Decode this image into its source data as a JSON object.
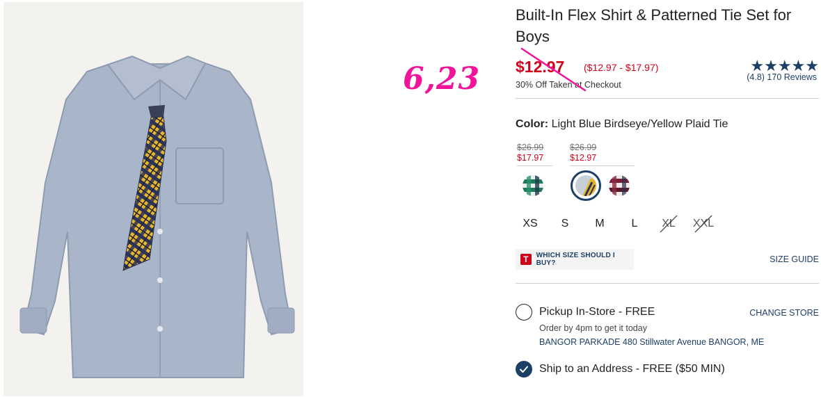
{
  "product": {
    "title": "Built-In Flex Shirt & Patterned Tie Set for Boys",
    "price_now": "$12.97",
    "price_range": "($12.97 - $17.97)",
    "promo": "30% Off Taken at Checkout",
    "stars": "★★★★★",
    "rating_text": "(4.8) 170 Reviews",
    "rating": 4.8,
    "image_icon": "shirt-and-tie-photo"
  },
  "annotation": {
    "text": "6,23",
    "color": "#f0149b"
  },
  "color_selector": {
    "label": "Color:",
    "value": "Light Blue Birdseye/Yellow Plaid Tie",
    "price_groups": [
      {
        "was": "$26.99",
        "now": "$17.97"
      },
      {
        "was": "$26.99",
        "now": "$12.97"
      }
    ],
    "swatches": [
      {
        "name": "green-plaid",
        "selected": false
      },
      {
        "name": "blue-yellow-plaid",
        "selected": true
      },
      {
        "name": "burgundy-plaid",
        "selected": false
      }
    ]
  },
  "sizes": [
    {
      "label": "XS",
      "available": true
    },
    {
      "label": "S",
      "available": true
    },
    {
      "label": "M",
      "available": true
    },
    {
      "label": "L",
      "available": true
    },
    {
      "label": "XL",
      "available": false
    },
    {
      "label": "XXL",
      "available": false
    }
  ],
  "size_help": {
    "icon_letter": "T",
    "label": "WHICH SIZE SHOULD I BUY?",
    "guide_link": "SIZE GUIDE"
  },
  "fulfillment": {
    "pickup": {
      "label": "Pickup In-Store - FREE",
      "sub": "Order by 4pm to get it today",
      "store": "BANGOR PARKADE 480 Stillwater Avenue  BANGOR, ME",
      "change_link": "CHANGE STORE",
      "selected": false
    },
    "ship": {
      "label": "Ship to an Address - FREE ($50 MIN)",
      "selected": true
    }
  },
  "colors": {
    "sale_red": "#d0021b",
    "navy": "#1c3f66",
    "annotation_pink": "#f0149b"
  }
}
